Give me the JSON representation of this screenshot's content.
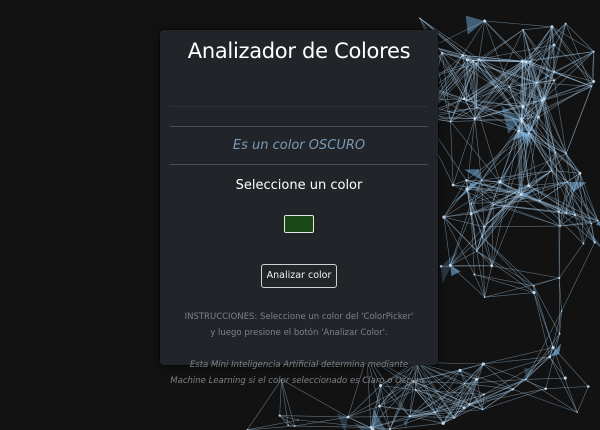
{
  "card": {
    "title": "Analizador de Colores",
    "result_text": "Es un color OSCURO",
    "picker_label": "Seleccione un color",
    "selected_color": "#1c4717",
    "analyze_button_label": "Analizar color",
    "instructions": [
      "INSTRUCCIONES: Seleccione un color del 'ColorPicker'",
      "y luego presione el botón 'Analizar Color'."
    ],
    "note": [
      "Esta Mini Inteligencia Artificial determina mediante",
      "Machine Learning si el color seleccionado es Claro o Oscuro."
    ]
  },
  "colors": {
    "page_background": "#121212",
    "card_background": "#212529",
    "result_text": "#7c98b7",
    "network_lines": "#9ec3e0",
    "network_fill": "#6fa8d6"
  },
  "background_decoration": "network-graph"
}
